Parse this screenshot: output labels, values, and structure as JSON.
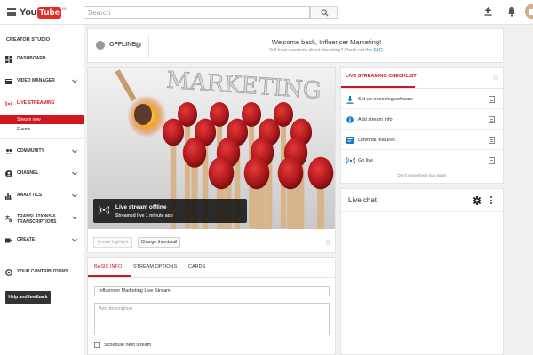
{
  "topbar": {
    "logo_you": "You",
    "logo_tube": "Tube",
    "logo_country": "IN",
    "search_placeholder": "Search"
  },
  "sidebar": {
    "heading": "CREATOR STUDIO",
    "items": [
      {
        "label": "DASHBOARD",
        "icon": "dashboard-icon"
      },
      {
        "label": "VIDEO MANAGER",
        "icon": "video-manager-icon"
      },
      {
        "label": "LIVE STREAMING",
        "icon": "live-icon"
      },
      {
        "label": "COMMUNITY",
        "icon": "community-icon"
      },
      {
        "label": "CHANNEL",
        "icon": "channel-icon"
      },
      {
        "label": "ANALYTICS",
        "icon": "analytics-icon"
      },
      {
        "label": "TRANSLATIONS &",
        "label2": "TRANSCRIPTIONS",
        "icon": "translate-icon"
      },
      {
        "label": "CREATE",
        "icon": "create-icon"
      },
      {
        "label": "YOUR CONTRIBUTIONS",
        "icon": "contributions-icon"
      }
    ],
    "live_sub": [
      "Stream now",
      "Events"
    ],
    "help_button": "Help and feedback"
  },
  "welcome": {
    "status": "OFFLINE",
    "title": "Welcome back, Influencer Marketing!",
    "subtitle": "Still have questions about streaming? Check out this ",
    "faq_link": "FAQ",
    "faq_end": "."
  },
  "video": {
    "thumbnail_text": "MARKETING",
    "overlay_title": "Live stream offline",
    "overlay_sub": "Streamed live 1 minute ago",
    "create_highlight": "Create highlight",
    "change_thumbnail": "Change thumbnail"
  },
  "checklist": {
    "title": "LIVE STREAMING CHECKLIST",
    "items": [
      {
        "label": "Set up encoding software",
        "icon": "download-icon"
      },
      {
        "label": "Add stream info",
        "icon": "info-icon"
      },
      {
        "label": "Optional features",
        "icon": "features-icon"
      },
      {
        "label": "Go live",
        "icon": "live-broadcast-icon"
      }
    ],
    "hide_tips": "Don't show these tips again"
  },
  "chat": {
    "title": "Live chat"
  },
  "info": {
    "tabs": [
      "BASIC INFO",
      "STREAM OPTIONS",
      "CARDS"
    ],
    "title_value": "Influencer Marketing Live Stream",
    "description_placeholder": "Add description",
    "schedule_label": "Schedule next stream"
  },
  "colors": {
    "accent": "#cc181e",
    "link": "#167ac6"
  }
}
